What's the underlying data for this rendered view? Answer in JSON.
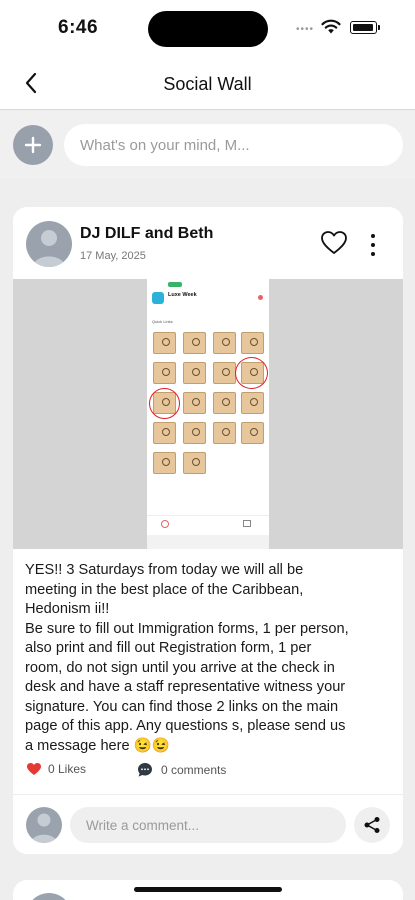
{
  "status_bar": {
    "time": "6:46"
  },
  "nav": {
    "title": "Social Wall"
  },
  "composer": {
    "placeholder": "What's on your mind, M..."
  },
  "post": {
    "author": "DJ DILF and Beth",
    "date": "17 May, 2025",
    "image": {
      "app_title": "Luxe Week",
      "section_label": "Quick Links"
    },
    "text_lines": [
      "YES!! 3 Saturdays from today we will all be",
      "meeting in the best place of the Caribbean,",
      "Hedonism ii!!",
      "Be sure to fill out Immigration forms, 1 per person,",
      "also print and fill out Registration form, 1 per",
      "room, do not sign until you arrive at the check in",
      "desk and have a staff representative witness your",
      "signature. You can find those 2 links on the main",
      "page of this app. Any questions s, please send us",
      "a message here 😉😉"
    ],
    "likes_label": "0 Likes",
    "comments_label": "0 comments",
    "comment_placeholder": "Write a comment..."
  },
  "colors": {
    "like_heart": "#e53935",
    "avatar_placeholder": "#9aa3ad",
    "tile": "#e6c69a",
    "annotation_circle": "#e02020"
  },
  "icons": [
    "back-chevron-icon",
    "plus-icon",
    "heart-outline-icon",
    "more-vertical-icon",
    "heart-filled-icon",
    "comment-bubble-icon",
    "share-icon",
    "wifi-icon",
    "battery-icon"
  ]
}
